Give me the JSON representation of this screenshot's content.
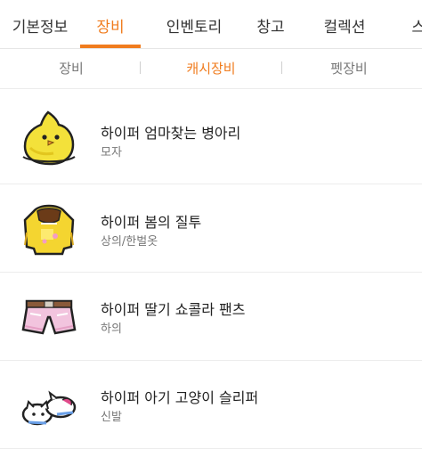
{
  "tabs": [
    {
      "label": "기본정보"
    },
    {
      "label": "장비"
    },
    {
      "label": "인벤토리"
    },
    {
      "label": "창고"
    },
    {
      "label": "컬렉션"
    },
    {
      "label": "스킬"
    }
  ],
  "active_tab": "장비",
  "subtabs": [
    {
      "label": "장비"
    },
    {
      "label": "캐시장비"
    },
    {
      "label": "펫장비"
    }
  ],
  "active_subtab": "캐시장비",
  "items": [
    {
      "name": "하이퍼 엄마찾는 병아리",
      "category": "모자",
      "icon": "chick-hat-icon"
    },
    {
      "name": "하이퍼 봄의 질투",
      "category": "상의/한벌옷",
      "icon": "yellow-hoodie-icon"
    },
    {
      "name": "하이퍼 딸기 쇼콜라 팬츠",
      "category": "하의",
      "icon": "pink-shorts-icon"
    },
    {
      "name": "하이퍼 아기 고양이 슬리퍼",
      "category": "신발",
      "icon": "cat-slippers-icon"
    }
  ],
  "colors": {
    "accent": "#f07c1e"
  }
}
